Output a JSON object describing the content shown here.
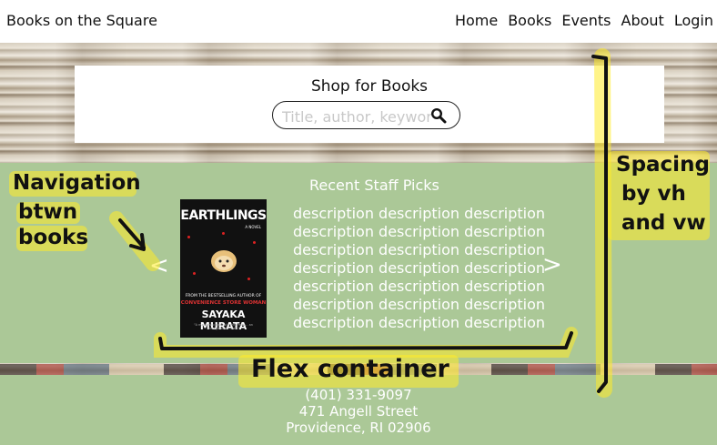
{
  "header": {
    "brand": "Books on the Square",
    "nav": [
      "Home",
      "Books",
      "Events",
      "About",
      "Login"
    ]
  },
  "shop": {
    "title": "Shop for Books",
    "search_placeholder": "Title, author, keyword",
    "search_icon": "search-icon"
  },
  "staff_picks": {
    "title": "Recent Staff Picks",
    "prev_label": "<",
    "next_label": ">",
    "book": {
      "title": "EARTHLINGS",
      "subtitle": "A NOVEL",
      "tagline_1": "FROM THE BESTSELLING AUTHOR OF",
      "tagline_2": "CONVENIENCE STORE WOMAN",
      "author": "SAYAKA MURATA",
      "quote": "\"A manifesto against conformity... an unforgettable read.\""
    },
    "description_lines": [
      "description description description",
      "description description description",
      "description description description",
      "description description description",
      "description description description",
      "description description description",
      "description description description"
    ]
  },
  "footer": {
    "phone": "(401) 331-9097",
    "street": "471 Angell Street",
    "city": "Providence, RI 02906"
  },
  "annotations": {
    "navigation": [
      "Navigation",
      "btwn",
      "books"
    ],
    "flex": "Flex container",
    "spacing": [
      "Spacing",
      "by vh",
      "and vw"
    ]
  },
  "colors": {
    "green": "#abc897",
    "highlight": "#ffeb28"
  }
}
